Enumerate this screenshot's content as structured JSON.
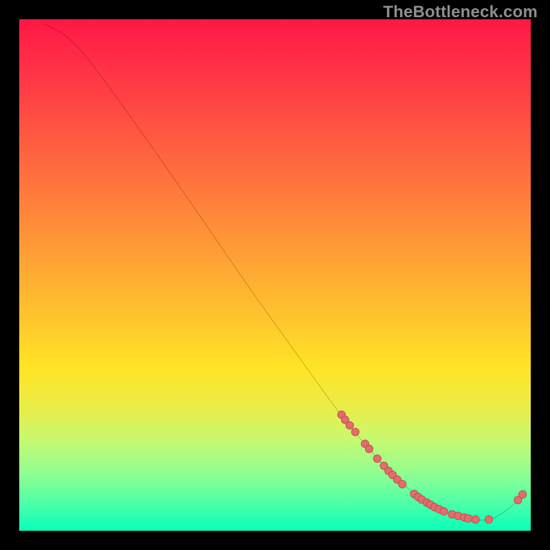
{
  "watermark": "TheBottleneck.com",
  "colors": {
    "background": "#000000",
    "curve_stroke": "#000000",
    "marker_fill": "#e46c6c",
    "marker_stroke": "#b84a4a"
  },
  "chart_data": {
    "type": "line",
    "title": "",
    "xlabel": "",
    "ylabel": "",
    "xlim": [
      0,
      100
    ],
    "ylim": [
      0,
      100
    ],
    "grid": false,
    "legend": false,
    "curve": [
      {
        "x": 5,
        "y": 99
      },
      {
        "x": 8,
        "y": 97.5
      },
      {
        "x": 11,
        "y": 95
      },
      {
        "x": 14,
        "y": 91.5
      },
      {
        "x": 17,
        "y": 87.5
      },
      {
        "x": 21,
        "y": 82
      },
      {
        "x": 27,
        "y": 73.5
      },
      {
        "x": 35,
        "y": 62
      },
      {
        "x": 45,
        "y": 47.5
      },
      {
        "x": 55,
        "y": 33.5
      },
      {
        "x": 63,
        "y": 22.5
      },
      {
        "x": 68,
        "y": 16.5
      },
      {
        "x": 72,
        "y": 12
      },
      {
        "x": 76,
        "y": 8.3
      },
      {
        "x": 80,
        "y": 5.3
      },
      {
        "x": 84,
        "y": 3.3
      },
      {
        "x": 88,
        "y": 2.3
      },
      {
        "x": 91,
        "y": 2.1
      },
      {
        "x": 93,
        "y": 2.6
      },
      {
        "x": 95.5,
        "y": 4.2
      },
      {
        "x": 97.5,
        "y": 6.0
      },
      {
        "x": 99,
        "y": 8.0
      }
    ],
    "markers": [
      {
        "x": 63.0,
        "y": 22.7
      },
      {
        "x": 63.7,
        "y": 21.7
      },
      {
        "x": 64.6,
        "y": 20.6
      },
      {
        "x": 65.7,
        "y": 19.3
      },
      {
        "x": 67.6,
        "y": 17.0
      },
      {
        "x": 68.4,
        "y": 16.0
      },
      {
        "x": 70.0,
        "y": 14.1
      },
      {
        "x": 71.3,
        "y": 12.7
      },
      {
        "x": 72.2,
        "y": 11.7
      },
      {
        "x": 73.0,
        "y": 10.9
      },
      {
        "x": 73.9,
        "y": 10.0
      },
      {
        "x": 74.9,
        "y": 9.1
      },
      {
        "x": 77.2,
        "y": 7.2
      },
      {
        "x": 78.0,
        "y": 6.6
      },
      {
        "x": 78.7,
        "y": 6.1
      },
      {
        "x": 79.7,
        "y": 5.5
      },
      {
        "x": 80.4,
        "y": 5.1
      },
      {
        "x": 81.2,
        "y": 4.6
      },
      {
        "x": 82.1,
        "y": 4.2
      },
      {
        "x": 83.0,
        "y": 3.8
      },
      {
        "x": 84.6,
        "y": 3.2
      },
      {
        "x": 85.8,
        "y": 2.9
      },
      {
        "x": 87.0,
        "y": 2.6
      },
      {
        "x": 87.8,
        "y": 2.4
      },
      {
        "x": 89.2,
        "y": 2.2
      },
      {
        "x": 91.8,
        "y": 2.2
      },
      {
        "x": 97.5,
        "y": 6.0
      },
      {
        "x": 98.4,
        "y": 7.1
      }
    ]
  }
}
